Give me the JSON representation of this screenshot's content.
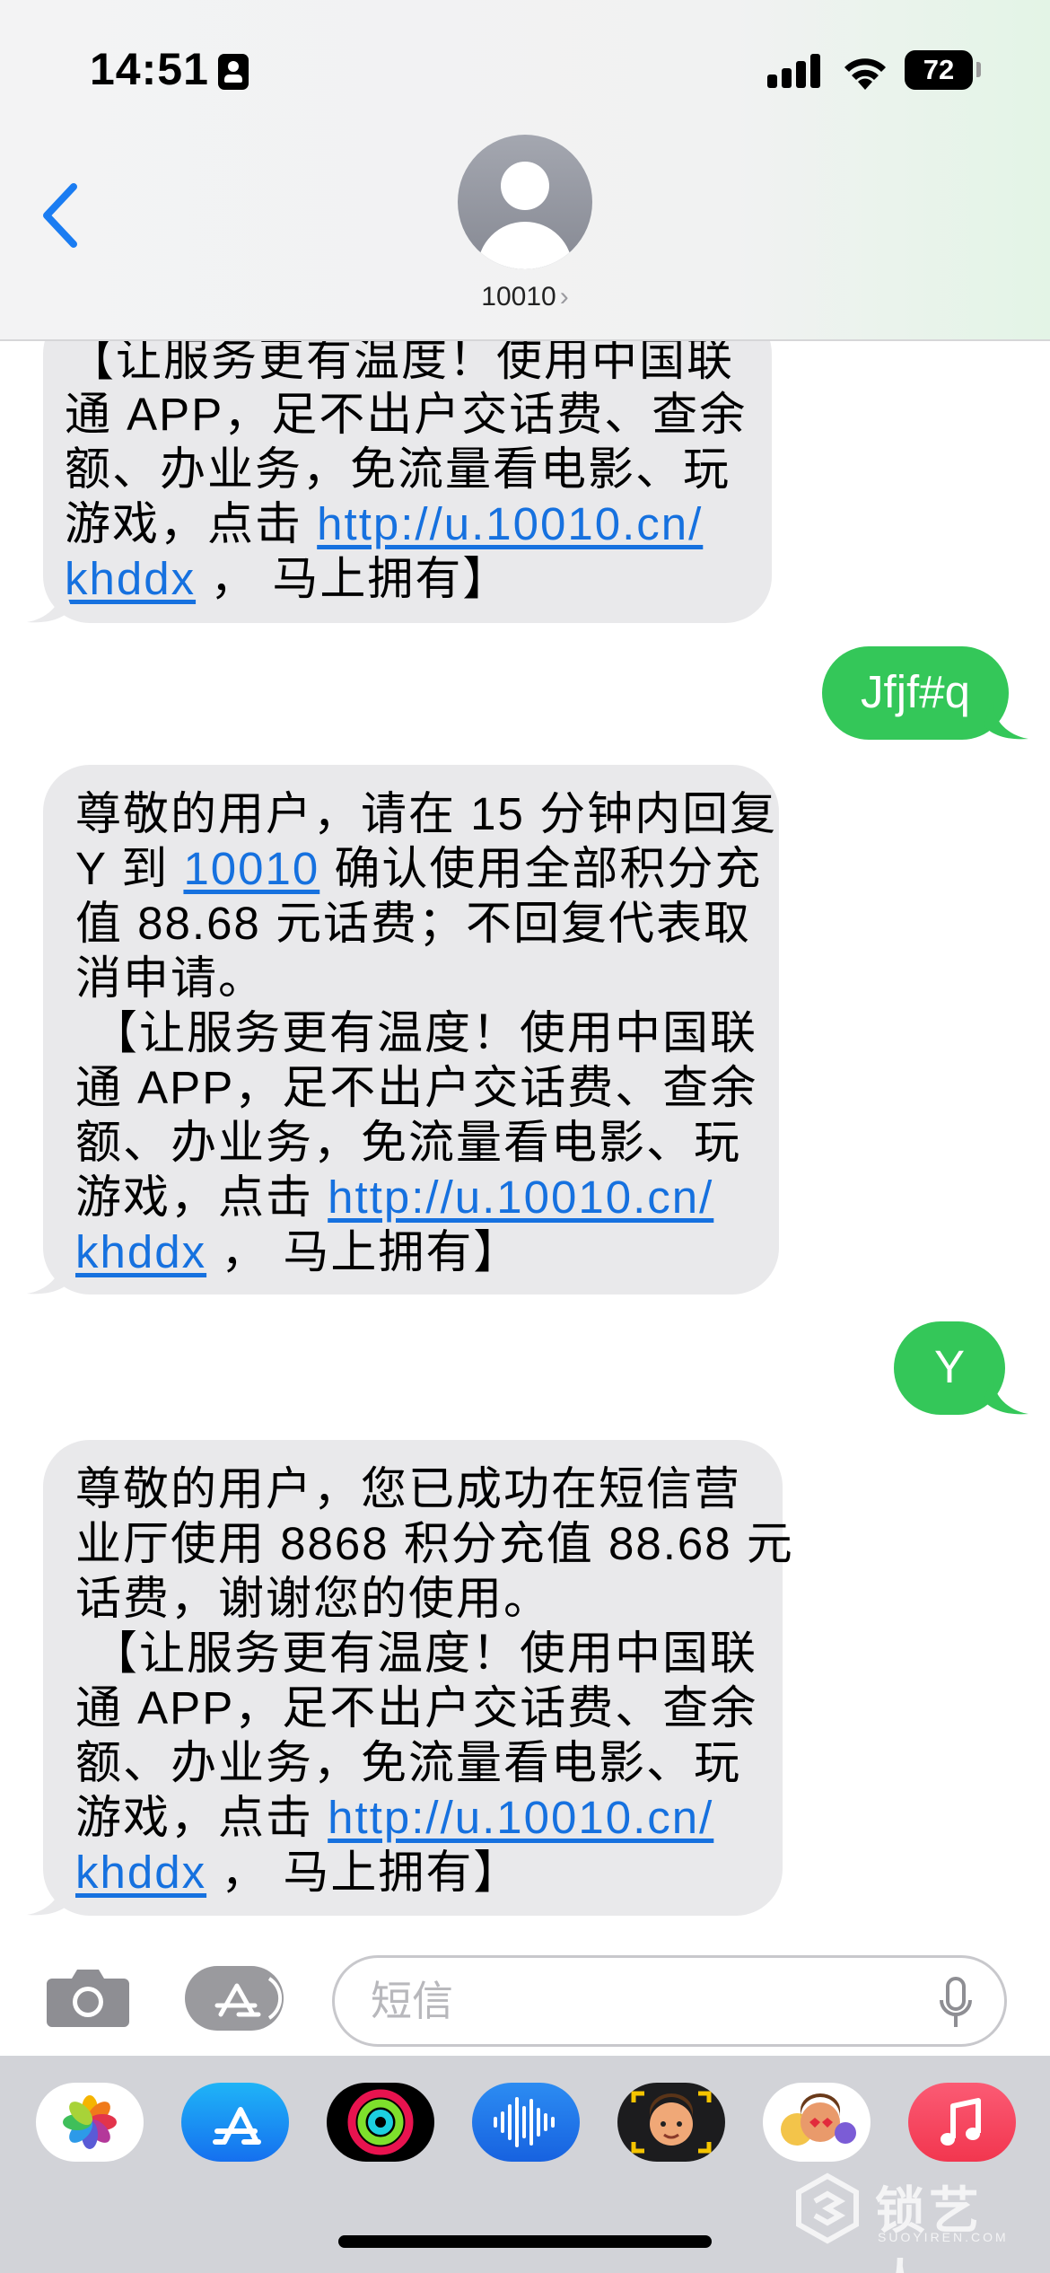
{
  "status_bar": {
    "time": "14:51",
    "battery": "72"
  },
  "contact": {
    "name": "10010",
    "chevron": "›"
  },
  "messages": {
    "m1": {
      "lines": [
        "【让服务更有温度！使用中国联",
        "通 APP，足不出户交话费、查余",
        "额、办业务，免流量看电影、玩"
      ],
      "pre_link": "游戏，点击 ",
      "link": "http://u.10010.cn/",
      "link2": "khddx",
      "post_link": " ， 马上拥有】"
    },
    "m2": {
      "text": "Jfjf#q"
    },
    "m3": {
      "line1": "尊敬的用户，请在 15 分钟内回复",
      "line2_pre": "Y 到 ",
      "line2_link": "10010",
      "line2_post": " 确认使用全部积分充",
      "line3": "值 88.68 元话费；不回复代表取",
      "line4": "消申请。",
      "lines": [
        "【让服务更有温度！使用中国联",
        "通 APP，足不出户交话费、查余",
        "额、办业务，免流量看电影、玩"
      ],
      "pre_link": "游戏，点击 ",
      "link": "http://u.10010.cn/",
      "link2": "khddx",
      "post_link": " ， 马上拥有】"
    },
    "m4": {
      "text": "Y"
    },
    "m5": {
      "line1": "尊敬的用户，您已成功在短信营",
      "line2": "业厅使用 8868 积分充值 88.68 元",
      "line3": "话费，谢谢您的使用。",
      "lines": [
        "【让服务更有温度！使用中国联",
        "通 APP，足不出户交话费、查余",
        "额、办业务，免流量看电影、玩"
      ],
      "pre_link": "游戏，点击 ",
      "link": "http://u.10010.cn/",
      "link2": "khddx",
      "post_link": " ， 马上拥有】"
    }
  },
  "compose": {
    "placeholder": "短信"
  },
  "apps": [
    "photos-app-icon",
    "app-store-icon",
    "activity-icon",
    "voice-memo-icon",
    "memoji-icon",
    "animoji-stickers-icon",
    "music-icon"
  ],
  "watermark": {
    "text": "锁艺人",
    "sub": "SUOYIREN.COM"
  },
  "colors": {
    "incoming": "#e9e9eb",
    "outgoing": "#34c759",
    "link": "#1671df",
    "accent": "#1a7cf2"
  }
}
